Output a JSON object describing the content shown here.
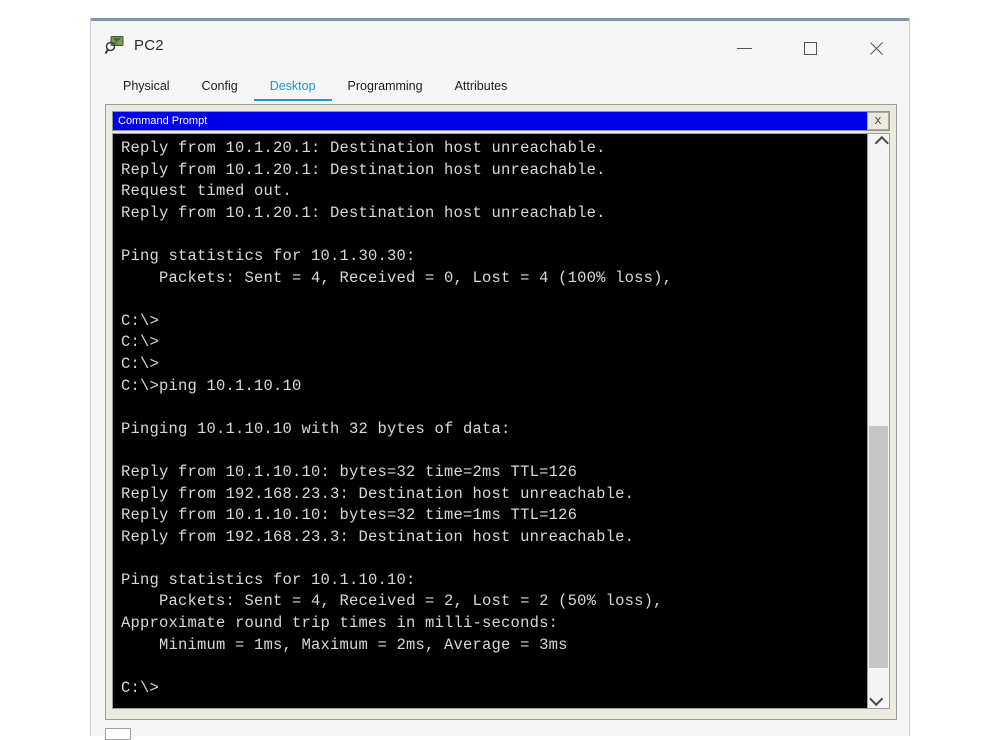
{
  "window": {
    "title": "PC2",
    "icon": "inspect-magnifier-icon",
    "controls": {
      "minimize": "minimize-icon",
      "maximize": "maximize-icon",
      "close": "close-icon"
    }
  },
  "tabs": [
    {
      "label": "Physical",
      "active": false
    },
    {
      "label": "Config",
      "active": false
    },
    {
      "label": "Desktop",
      "active": true
    },
    {
      "label": "Programming",
      "active": false
    },
    {
      "label": "Attributes",
      "active": false
    }
  ],
  "command_prompt": {
    "title": "Command Prompt",
    "close_label": "X",
    "accent_color": "#0000e8",
    "background_color": "#000000",
    "foreground_color": "#d8d8d8",
    "lines": [
      "Reply from 10.1.20.1: Destination host unreachable.",
      "Reply from 10.1.20.1: Destination host unreachable.",
      "Request timed out.",
      "Reply from 10.1.20.1: Destination host unreachable.",
      "",
      "Ping statistics for 10.1.30.30:",
      "    Packets: Sent = 4, Received = 0, Lost = 4 (100% loss),",
      "",
      "C:\\>",
      "C:\\>",
      "C:\\>",
      "C:\\>ping 10.1.10.10",
      "",
      "Pinging 10.1.10.10 with 32 bytes of data:",
      "",
      "Reply from 10.1.10.10: bytes=32 time=2ms TTL=126",
      "Reply from 192.168.23.3: Destination host unreachable.",
      "Reply from 10.1.10.10: bytes=32 time=1ms TTL=126",
      "Reply from 192.168.23.3: Destination host unreachable.",
      "",
      "Ping statistics for 10.1.10.10:",
      "    Packets: Sent = 4, Received = 2, Lost = 2 (50% loss),",
      "Approximate round trip times in milli-seconds:",
      "    Minimum = 1ms, Maximum = 2ms, Average = 3ms",
      "",
      "C:\\>"
    ],
    "scrollbar": {
      "up_arrow": "chevron-up-icon",
      "down_arrow": "chevron-down-icon"
    }
  }
}
